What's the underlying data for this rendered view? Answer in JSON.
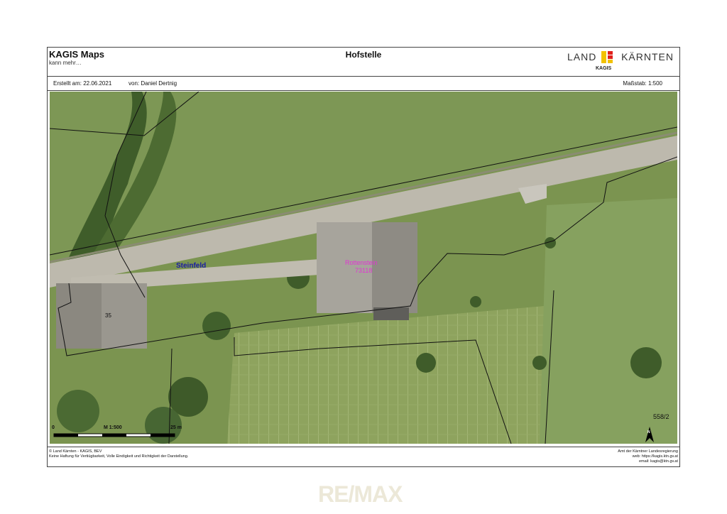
{
  "header": {
    "app_title": "KAGIS Maps",
    "app_subtitle": "kann mehr…",
    "document_title": "Hofstelle",
    "logo": {
      "word1": "LAND",
      "word2": "KÄRNTEN",
      "sub": "KAGIS"
    }
  },
  "meta": {
    "created": "Erstellt am:  22.06.2021",
    "author": "von:  Daniel Dertnig",
    "scale": "Maßstab:  1:500"
  },
  "map": {
    "place_label": "Steinfeld",
    "building_name": "Rottenstein",
    "building_number": "73118",
    "house_number": "35",
    "parcel_number": "558/2",
    "scalebar": {
      "start": "0",
      "middle": "M 1:500",
      "end": "25 m"
    },
    "north_label": "N"
  },
  "footer": {
    "left_line1": "© Land Kärnten - KAGIS, BEV",
    "left_line2": "Keine Haftung für Vertiügbarkeit, Volle Eindigkeit und Richtigkeit der Darstellung.",
    "right_line1": "Amt der Kärntner Landesregierung",
    "right_line2": "web: https://kagis.ktn.gv.at",
    "right_line3": "email: kagis@ktn.gv.at"
  },
  "watermark": "RE/MAX",
  "colors": {
    "grass": "#7f9a55",
    "road": "#bdb9ad",
    "place_label": "#1a1aa8",
    "building_label": "#e233d4"
  }
}
